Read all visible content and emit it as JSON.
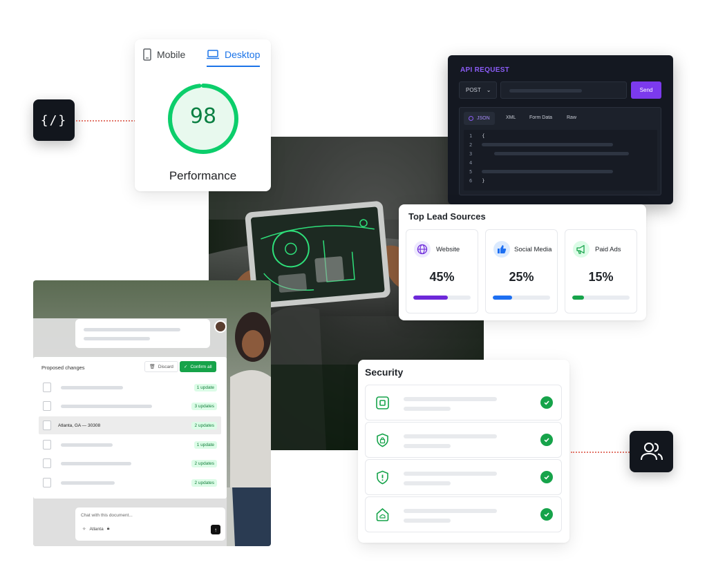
{
  "perf_card": {
    "tabs": [
      {
        "label": "Mobile",
        "icon": "phone-icon",
        "active": false
      },
      {
        "label": "Desktop",
        "icon": "laptop-icon",
        "active": true
      }
    ],
    "score": "98",
    "label": "Performance",
    "score_color": "#0cce6b"
  },
  "api_card": {
    "title": "API REQUEST",
    "method": "POST",
    "send_label": "Send",
    "tabs": [
      "JSON",
      "XML",
      "Form Data",
      "Raw"
    ],
    "line_numbers": [
      "1",
      "2",
      "3",
      "4",
      "5",
      "6"
    ],
    "open_brace": "{",
    "close_brace": "}",
    "accent": "#7c3aed"
  },
  "lead_sources": {
    "title": "Top Lead Sources",
    "items": [
      {
        "label": "Website",
        "percent": "45%",
        "value": 0.45,
        "icon": "globe-icon",
        "color": "#6d28d9"
      },
      {
        "label": "Social Media",
        "percent": "25%",
        "value": 0.25,
        "icon": "thumbs-up-icon",
        "color": "#1d6ff2"
      },
      {
        "label": "Paid Ads",
        "percent": "15%",
        "value": 0.15,
        "icon": "megaphone-icon",
        "color": "#16a34a"
      }
    ]
  },
  "security": {
    "title": "Security",
    "rows": [
      {
        "icon": "chip-icon",
        "status": "check-icon"
      },
      {
        "icon": "shield-lock-icon",
        "status": "check-icon"
      },
      {
        "icon": "shield-alert-icon",
        "status": "check-icon"
      },
      {
        "icon": "cloud-shield-icon",
        "status": "check-icon"
      }
    ],
    "accent": "#16a34a"
  },
  "doc_card": {
    "proposed_title": "Proposed changes",
    "discard_label": "Discard",
    "confirm_label": "Confirm all",
    "rows": [
      {
        "text": "",
        "badge": "1 update",
        "highlighted": false
      },
      {
        "text": "",
        "badge": "3 updates",
        "highlighted": false
      },
      {
        "text": "Atlanta, GA — 30308",
        "badge": "2 updates",
        "highlighted": true
      },
      {
        "text": "",
        "badge": "1 update",
        "highlighted": false
      },
      {
        "text": "",
        "badge": "2 updates",
        "highlighted": false
      },
      {
        "text": "",
        "badge": "2 updates",
        "highlighted": false
      }
    ],
    "chat_placeholder": "Chat with this document...",
    "chat_context": "Atlanta"
  },
  "floating_icons": {
    "code": "{/}",
    "users": "users-icon"
  }
}
